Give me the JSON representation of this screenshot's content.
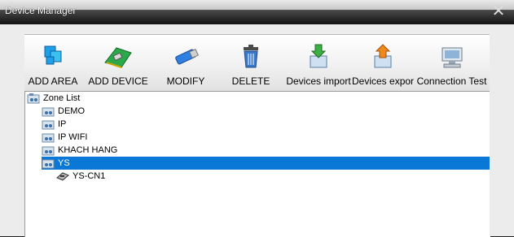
{
  "window": {
    "title": "Device Manager",
    "close_glyph": "✕"
  },
  "toolbar": {
    "buttons": [
      {
        "label": "ADD AREA",
        "icon": "add-area-icon"
      },
      {
        "label": "ADD DEVICE",
        "icon": "add-device-icon"
      },
      {
        "label": "MODIFY",
        "icon": "modify-icon"
      },
      {
        "label": "DELETE",
        "icon": "delete-icon"
      },
      {
        "label": "Devices import",
        "icon": "import-icon"
      },
      {
        "label": "Devices expor",
        "icon": "export-icon"
      },
      {
        "label": "Connection  Test",
        "icon": "connection-test-icon"
      }
    ]
  },
  "tree": {
    "root": "Zone List",
    "zones": [
      "DEMO",
      "IP",
      "IP WIFI",
      "KHACH HANG",
      "YS"
    ],
    "selected_zone": "YS",
    "devices": [
      "YS-CN1"
    ]
  },
  "colors": {
    "selection": "#0a78d7"
  }
}
